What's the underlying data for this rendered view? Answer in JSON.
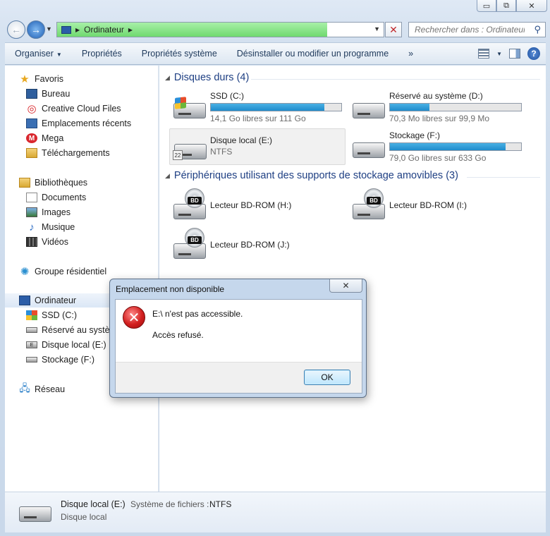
{
  "window": {
    "caption": {
      "minimize": "▭",
      "maximize": "⧉",
      "close": "✕"
    }
  },
  "address": {
    "crumb": "Ordinateur",
    "search_placeholder": "Rechercher dans : Ordinateur"
  },
  "toolbar": {
    "items": [
      "Organiser",
      "Propriétés",
      "Propriétés système",
      "Désinstaller ou modifier un programme",
      "»"
    ]
  },
  "nav": {
    "favoris": "Favoris",
    "bureau": "Bureau",
    "creative_cloud": "Creative Cloud Files",
    "recents": "Emplacements récents",
    "mega": "Mega",
    "telechargements": "Téléchargements",
    "bibliotheques": "Bibliothèques",
    "documents": "Documents",
    "images": "Images",
    "musique": "Musique",
    "videos": "Vidéos",
    "groupe": "Groupe résidentiel",
    "ordinateur": "Ordinateur",
    "ssd": "SSD (C:)",
    "reserve": "Réservé au système",
    "disque_local": "Disque local (E:)",
    "stockage": "Stockage (F:)",
    "reseau": "Réseau"
  },
  "groups": {
    "hard_disks": "Disques durs (4)",
    "removable": "Périphériques utilisant des supports de stockage amovibles (3)"
  },
  "drives": {
    "c": {
      "name": "SSD (C:)",
      "sub": "14,1 Go libres sur 111 Go",
      "used_fraction": 0.87
    },
    "d": {
      "name": "Réservé au système (D:)",
      "sub": "70,3 Mo libres sur 99,9 Mo",
      "used_fraction": 0.3
    },
    "e": {
      "name": "Disque local (E:)",
      "sub": "NTFS"
    },
    "f": {
      "name": "Stockage (F:)",
      "sub": "79,0 Go libres sur 633 Go",
      "used_fraction": 0.88
    },
    "h": {
      "name": "Lecteur BD-ROM (H:)"
    },
    "i": {
      "name": "Lecteur BD-ROM (I:)"
    },
    "j": {
      "name": "Lecteur BD-ROM (J:)"
    },
    "bd_badge": "BD"
  },
  "details": {
    "name": "Disque local (E:)",
    "fs_label": "Système de fichiers :",
    "fs_value": "NTFS",
    "type": "Disque local"
  },
  "dialog": {
    "title": "Emplacement non disponible",
    "close": "✕",
    "message": "E:\\ n'est pas accessible.",
    "detail": "Accès refusé.",
    "ok": "OK"
  },
  "colors": {
    "bar_fill": "#1f8ccc",
    "address_progress": "#6fd96f",
    "group_title": "#1e3f83",
    "error_red": "#d21f1f"
  }
}
